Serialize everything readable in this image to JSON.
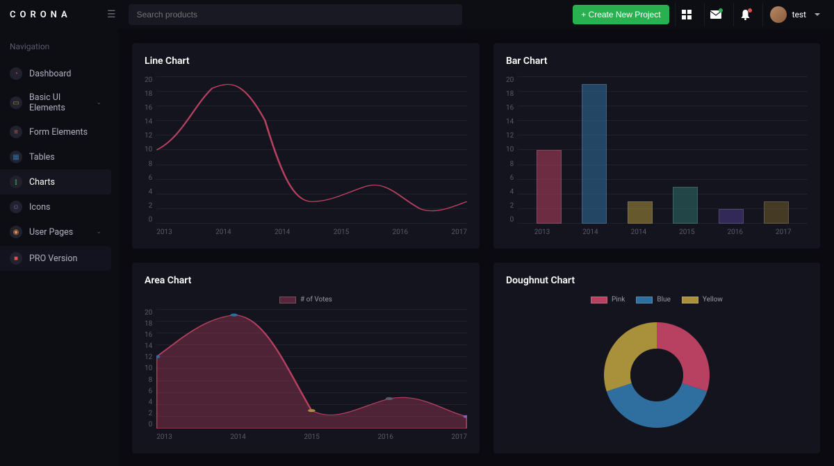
{
  "brand": "CORONA",
  "search": {
    "placeholder": "Search products"
  },
  "header": {
    "create_label": "+ Create New Project",
    "username": "test"
  },
  "sidebar": {
    "heading": "Navigation",
    "items": [
      {
        "label": "Dashboard",
        "expandable": false
      },
      {
        "label": "Basic UI Elements",
        "expandable": true
      },
      {
        "label": "Form Elements",
        "expandable": false
      },
      {
        "label": "Tables",
        "expandable": false
      },
      {
        "label": "Charts",
        "expandable": false,
        "active": true
      },
      {
        "label": "Icons",
        "expandable": false
      },
      {
        "label": "User Pages",
        "expandable": true
      },
      {
        "label": "PRO Version",
        "expandable": false,
        "pro": true
      }
    ]
  },
  "cards": {
    "line": {
      "title": "Line Chart"
    },
    "bar": {
      "title": "Bar Chart"
    },
    "area": {
      "title": "Area Chart",
      "legend_label": "# of Votes"
    },
    "doughnut": {
      "title": "Doughnut Chart",
      "legend": [
        "Pink",
        "Blue",
        "Yellow"
      ]
    }
  },
  "colors": {
    "pink": "#b84060",
    "blue": "#2f6fa0",
    "yellow": "#a8913a",
    "teal": "#2d6d6a",
    "purple": "#4b3a8a",
    "olive": "#6d5a2a"
  },
  "chart_data": [
    {
      "id": "line",
      "type": "line",
      "title": "Line Chart",
      "x": [
        2013,
        2014,
        2015,
        2016,
        2017
      ],
      "series": [
        {
          "name": "",
          "values": [
            10,
            19,
            3,
            5,
            2,
            3
          ],
          "x": [
            2013,
            2014,
            2014.6,
            2015,
            2016,
            2017
          ],
          "color": "#b84060"
        }
      ],
      "ylim": [
        0,
        20
      ],
      "yticks": [
        0,
        2,
        4,
        6,
        8,
        10,
        12,
        14,
        16,
        18,
        20
      ]
    },
    {
      "id": "bar",
      "type": "bar",
      "title": "Bar Chart",
      "categories": [
        "2013",
        "2014",
        "2014",
        "2015",
        "2016",
        "2017"
      ],
      "values": [
        10,
        19,
        3,
        5,
        2,
        3
      ],
      "colors": [
        "#b84060",
        "#2f6fa0",
        "#a8913a",
        "#2d6d6a",
        "#4b3a8a",
        "#6d5a2a"
      ],
      "ylim": [
        0,
        20
      ],
      "yticks": [
        0,
        2,
        4,
        6,
        8,
        10,
        12,
        14,
        16,
        18,
        20
      ]
    },
    {
      "id": "area",
      "type": "area",
      "title": "Area Chart",
      "legend": [
        "# of Votes"
      ],
      "x": [
        2013,
        2014,
        2015,
        2016,
        2017
      ],
      "series": [
        {
          "name": "# of Votes",
          "values": [
            12,
            19,
            3,
            5,
            2
          ],
          "color": "#b84060"
        }
      ],
      "ylim": [
        0,
        20
      ],
      "yticks": [
        0,
        2,
        4,
        6,
        8,
        10,
        12,
        14,
        16,
        18,
        20
      ]
    },
    {
      "id": "doughnut",
      "type": "pie",
      "title": "Doughnut Chart",
      "labels": [
        "Pink",
        "Blue",
        "Yellow"
      ],
      "values": [
        30,
        40,
        30
      ],
      "colors": [
        "#b84060",
        "#2f6fa0",
        "#a8913a"
      ]
    }
  ]
}
